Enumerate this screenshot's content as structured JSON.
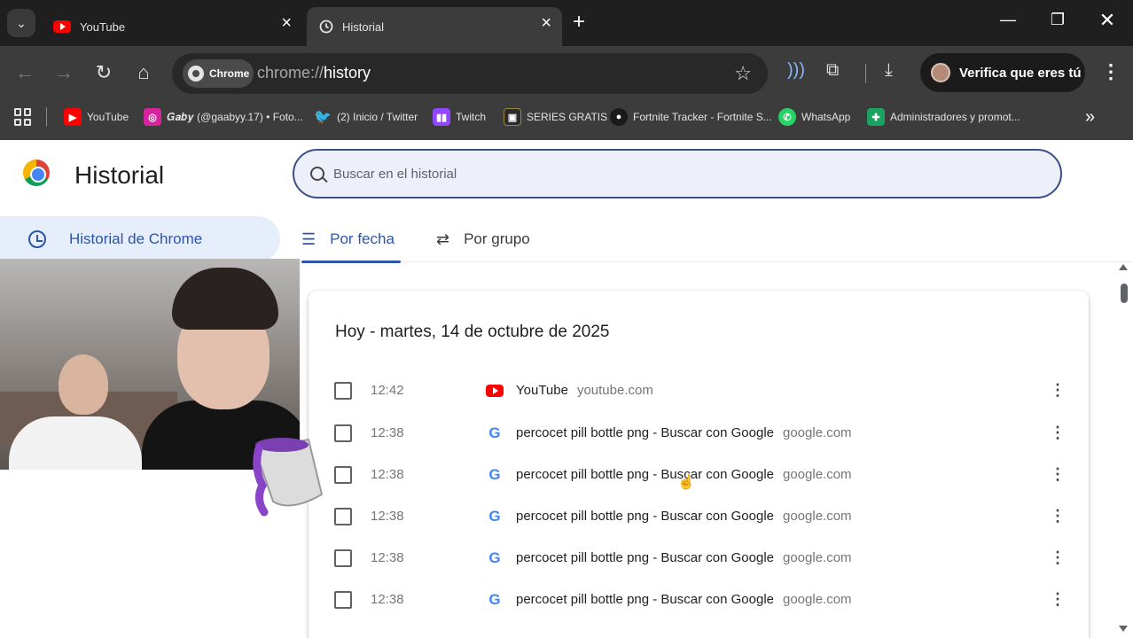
{
  "browser": {
    "tabs": [
      {
        "title": "YouTube",
        "icon": "youtube-icon",
        "active": false
      },
      {
        "title": "Historial",
        "icon": "history-icon",
        "active": true
      }
    ],
    "address": {
      "chip": "Chrome",
      "url_prefix": "chrome://",
      "url_path": "history"
    },
    "profile_label": "Verifica que eres tú",
    "bookmarks": [
      {
        "label": "YouTube",
        "icon": "youtube-icon",
        "color": "#ff0000"
      },
      {
        "label": "𝑮𝒂𝒃𝒚 (@gaabyy.17) • Foto...",
        "icon": "instagram-icon",
        "color": "#d6249f"
      },
      {
        "label": "(2) Inicio / Twitter",
        "icon": "twitter-icon",
        "color": "#1da1f2"
      },
      {
        "label": "Twitch",
        "icon": "twitch-icon",
        "color": "#9146ff"
      },
      {
        "label": "SERIES GRATIS",
        "icon": "series-icon",
        "color": "#2b2b2b"
      },
      {
        "label": "Fortnite Tracker - Fortnite S...",
        "icon": "fortnite-icon",
        "color": "#1a1a1a"
      },
      {
        "label": "WhatsApp",
        "icon": "whatsapp-icon",
        "color": "#25d366"
      },
      {
        "label": "Administradores y promot...",
        "icon": "sheets-icon",
        "color": "#1aa260"
      }
    ]
  },
  "page": {
    "title": "Historial",
    "search_placeholder": "Buscar en el historial",
    "sidebar_item": "Historial de Chrome",
    "tabs": [
      "Por fecha",
      "Por grupo"
    ],
    "day_header": "Hoy - martes, 14 de octubre de 2025",
    "entries": [
      {
        "time": "12:42",
        "title": "YouTube",
        "domain": "youtube.com",
        "icon": "youtube-icon"
      },
      {
        "time": "12:38",
        "title": "percocet pill bottle png - Buscar con Google",
        "domain": "google.com",
        "icon": "google-icon"
      },
      {
        "time": "12:38",
        "title": "percocet pill bottle png - Buscar con Google",
        "domain": "google.com",
        "icon": "google-icon"
      },
      {
        "time": "12:38",
        "title": "percocet pill bottle png - Buscar con Google",
        "domain": "google.com",
        "icon": "google-icon"
      },
      {
        "time": "12:38",
        "title": "percocet pill bottle png - Buscar con Google",
        "domain": "google.com",
        "icon": "google-icon"
      },
      {
        "time": "12:38",
        "title": "percocet pill bottle png - Buscar con Google",
        "domain": "google.com",
        "icon": "google-icon"
      }
    ]
  },
  "colors": {
    "accent": "#2d54a8",
    "search_border": "#3c4f86",
    "toolbar": "#3c3c3c",
    "tabstrip": "#1f1f1f"
  }
}
